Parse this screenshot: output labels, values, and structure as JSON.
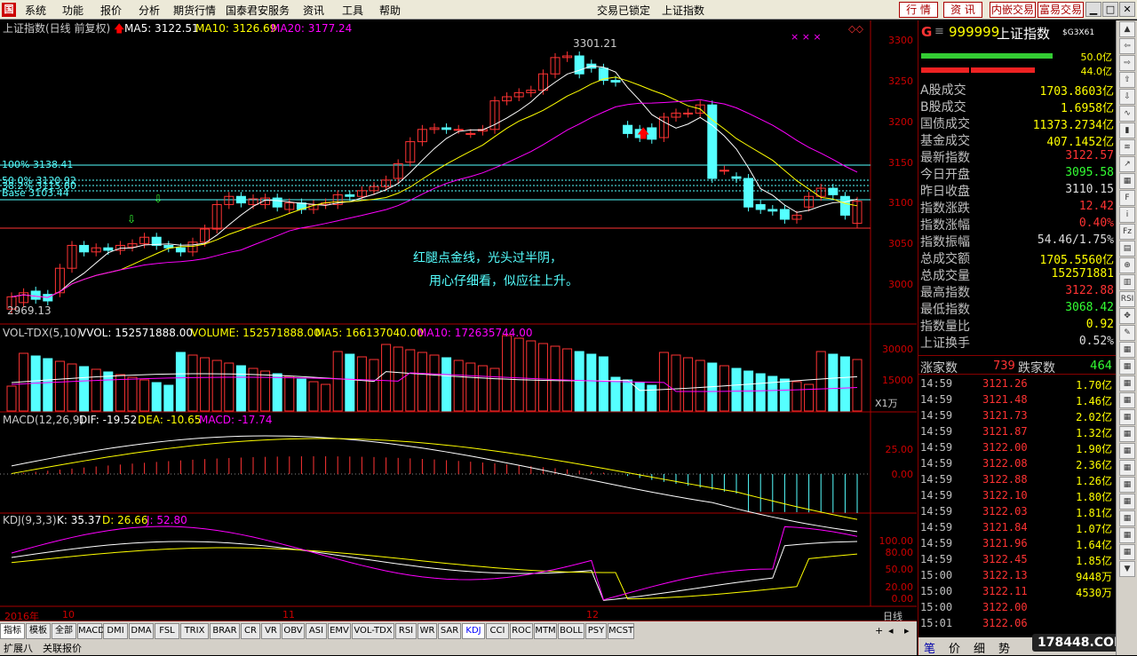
{
  "menu": {
    "items": [
      "系统",
      "功能",
      "报价",
      "分析",
      "期货行情",
      "国泰君安服务",
      "资讯",
      "工具",
      "帮助"
    ],
    "status": "交易已锁定",
    "index_name": "上证指数",
    "buttons": [
      "行 情",
      "资 讯",
      "内嵌交易",
      "富易交易"
    ]
  },
  "kline": {
    "title": "上证指数(日线 前复权)",
    "ma5": "MA5: 3122.51",
    "ma10": "MA10: 3126.69",
    "ma20": "MA20: 3177.24",
    "high_label": "3301.21",
    "low_label": "2969.13",
    "fib": [
      "100% 3138.41",
      "50.0% 3120.92",
      "38.2% 3115.80",
      "Base 3103.44"
    ],
    "annotation1": "红腿点金线，光头过半阴，",
    "annotation2": "用心仔细看，似应往上升。",
    "yticks": [
      "3300",
      "3250",
      "3200",
      "3150",
      "3100",
      "3050",
      "3000"
    ]
  },
  "vol": {
    "title": "VOL-TDX(5,10)",
    "vvol": "VVOL: 152571888.00",
    "volume": "VOLUME: 152571888.00",
    "ma5": "MA5: 166137040.00",
    "ma10": "MA10: 172635744.00",
    "yticks": [
      "30000",
      "15000"
    ],
    "unit": "X1万"
  },
  "macd": {
    "title": "MACD(12,26,9)",
    "dif": "DIF: -19.52",
    "dea": "DEA: -10.65",
    "macd": "MACD: -17.74",
    "yticks": [
      "25.00",
      "0.00"
    ]
  },
  "kdj": {
    "title": "KDJ(9,3,3)",
    "k": "K: 35.37",
    "d": "D: 26.66",
    "j": "J: 52.80",
    "yticks": [
      "100.00",
      "80.00",
      "50.00",
      "20.00",
      "0.00"
    ]
  },
  "time_axis": {
    "year": "2016年",
    "months": [
      "10",
      "11",
      "12"
    ],
    "period": "日线"
  },
  "tabs": [
    "指标",
    "模板",
    "全部",
    "MACD",
    "DMI",
    "DMA",
    "FSL",
    "TRIX",
    "BRAR",
    "CR",
    "VR",
    "OBV",
    "ASI",
    "EMV",
    "VOL-TDX",
    "RSI",
    "WR",
    "SAR",
    "KDJ",
    "CCI",
    "ROC",
    "MTM",
    "BOLL",
    "PSY",
    "MCST"
  ],
  "bottom_tabs": [
    "扩展八",
    "关联报价"
  ],
  "right": {
    "g": "G",
    "code": "999999",
    "name": "上证指数",
    "tag": "$G3X61",
    "bar1": "50.0亿",
    "bar2": "44.0亿",
    "rows": [
      {
        "k": "A股成交",
        "v": "1703.8603亿",
        "c": "#ff0"
      },
      {
        "k": "B股成交",
        "v": "1.6958亿",
        "c": "#ff0"
      },
      {
        "k": "国债成交",
        "v": "11373.2734亿",
        "c": "#ff0"
      },
      {
        "k": "基金成交",
        "v": "407.1452亿",
        "c": "#ff0"
      },
      {
        "k": "最新指数",
        "v": "3122.57",
        "c": "#f33"
      },
      {
        "k": "今日开盘",
        "v": "3095.58",
        "c": "#3f3"
      },
      {
        "k": "昨日收盘",
        "v": "3110.15",
        "c": "#ddd"
      },
      {
        "k": "指数涨跌",
        "v": "12.42",
        "c": "#f33"
      },
      {
        "k": "指数涨幅",
        "v": "0.40%",
        "c": "#f33"
      },
      {
        "k": "指数振幅",
        "v": "54.46/1.75%",
        "c": "#ddd"
      },
      {
        "k": "总成交额",
        "v": "1705.5560亿",
        "c": "#ff0"
      },
      {
        "k": "总成交量",
        "v": "152571881",
        "c": "#ff0"
      },
      {
        "k": "最高指数",
        "v": "3122.88",
        "c": "#f33"
      },
      {
        "k": "最低指数",
        "v": "3068.42",
        "c": "#3f3"
      },
      {
        "k": "指数量比",
        "v": "0.92",
        "c": "#ff0"
      },
      {
        "k": "上证换手",
        "v": "0.52%",
        "c": "#ddd"
      }
    ],
    "up_label": "涨家数",
    "up": "739",
    "down_label": "跌家数",
    "down": "464",
    "ticks": [
      {
        "t": "14:59",
        "p": "3121.26",
        "a": "1.70亿"
      },
      {
        "t": "14:59",
        "p": "3121.48",
        "a": "1.46亿"
      },
      {
        "t": "14:59",
        "p": "3121.73",
        "a": "2.02亿"
      },
      {
        "t": "14:59",
        "p": "3121.87",
        "a": "1.32亿"
      },
      {
        "t": "14:59",
        "p": "3122.00",
        "a": "1.90亿"
      },
      {
        "t": "14:59",
        "p": "3122.08",
        "a": "2.36亿"
      },
      {
        "t": "14:59",
        "p": "3122.88",
        "a": "1.26亿"
      },
      {
        "t": "14:59",
        "p": "3122.10",
        "a": "1.80亿"
      },
      {
        "t": "14:59",
        "p": "3122.03",
        "a": "1.81亿"
      },
      {
        "t": "14:59",
        "p": "3121.84",
        "a": "1.07亿"
      },
      {
        "t": "14:59",
        "p": "3121.96",
        "a": "1.64亿"
      },
      {
        "t": "14:59",
        "p": "3122.45",
        "a": "1.85亿"
      },
      {
        "t": "15:00",
        "p": "3122.13",
        "a": "9448万"
      },
      {
        "t": "15:00",
        "p": "3122.11",
        "a": "4530万"
      },
      {
        "t": "15:00",
        "p": "3122.00",
        "a": ""
      },
      {
        "t": "15:01",
        "p": "3122.06",
        "a": ""
      }
    ],
    "foot_tabs": [
      "笔",
      "价",
      "细",
      "势"
    ],
    "watermark": "178448.COM"
  }
}
